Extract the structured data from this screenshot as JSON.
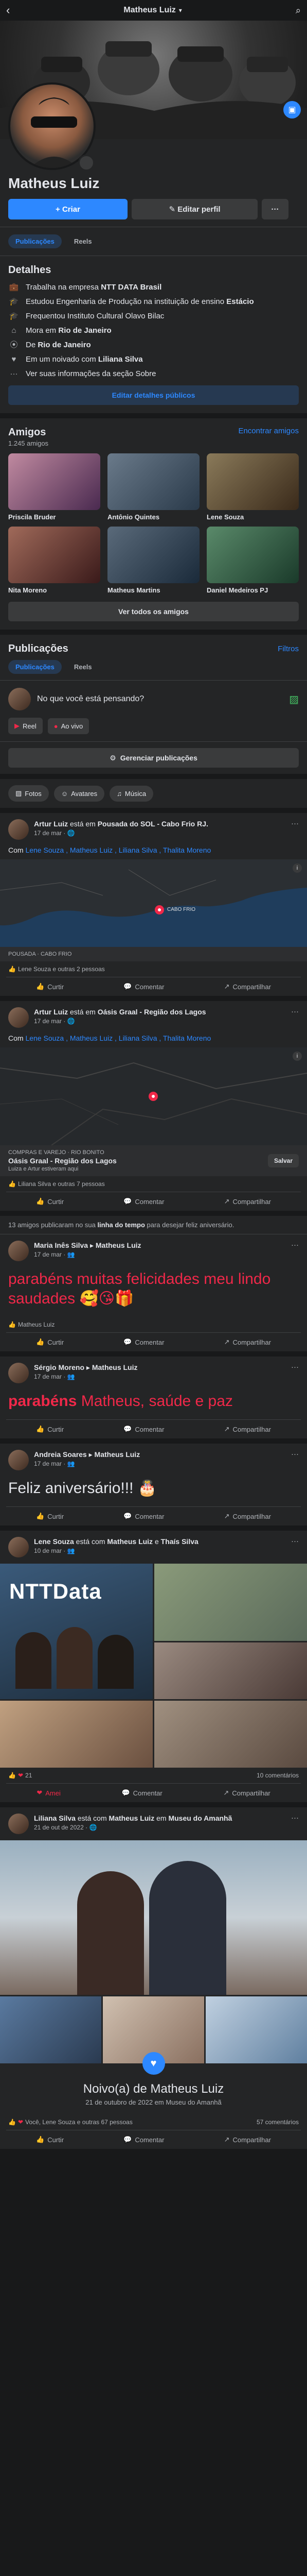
{
  "topbar": {
    "name": "Matheus Luiz",
    "chevron": "▾",
    "search_icon": "search-icon"
  },
  "profile": {
    "name": "Matheus Luiz",
    "create_label": "+ Criar",
    "edit_label": "✎ Editar perfil",
    "more_label": "···"
  },
  "tabs": {
    "posts": "Publicações",
    "reels": "Reels"
  },
  "details": {
    "title": "Detalhes",
    "items": [
      {
        "icon": "briefcase-icon",
        "pre": "Trabalha na empresa ",
        "bold": "NTT DATA Brasil"
      },
      {
        "icon": "graduation-icon",
        "pre": "Estudou Engenharia de Produção na instituição de ensino ",
        "bold": "Estácio"
      },
      {
        "icon": "graduation-icon",
        "pre": "Frequentou Instituto Cultural Olavo Bilac",
        "bold": ""
      },
      {
        "icon": "home-icon",
        "pre": "Mora em ",
        "bold": "Rio de Janeiro"
      },
      {
        "icon": "location-icon",
        "pre": "De ",
        "bold": "Rio de Janeiro"
      },
      {
        "icon": "heart-icon",
        "pre": "Em um noivado com ",
        "bold": "Liliana Silva"
      },
      {
        "icon": "ellipsis-icon",
        "pre": "Ver suas informações da seção Sobre",
        "bold": ""
      }
    ],
    "edit_label": "Editar detalhes públicos"
  },
  "friends": {
    "title": "Amigos",
    "count": "1.245 amigos",
    "find_label": "Encontrar amigos",
    "list": [
      {
        "name": "Priscila Bruder"
      },
      {
        "name": "Antônio Quintes"
      },
      {
        "name": "Lene Souza"
      },
      {
        "name": "Nita Moreno"
      },
      {
        "name": "Matheus Martins"
      },
      {
        "name": "Daniel Medeiros PJ"
      }
    ],
    "see_all": "Ver todos os amigos"
  },
  "publications": {
    "title": "Publicações",
    "filters": "Filtros",
    "tab_posts": "Publicações",
    "tab_reels": "Reels",
    "composer_placeholder": "No que você está pensando?",
    "reel_label": "Reel",
    "live_label": "Ao vivo",
    "manage_label": "Gerenciar publicações",
    "chips": [
      "Fotos",
      "Avatares",
      "Música"
    ]
  },
  "post1": {
    "author": "Artur Luiz",
    "text": " está em ",
    "place": "Pousada do SOL - Cabo Frio RJ.",
    "time": "17 de mar",
    "body_pre": "Com ",
    "tags": "Lene Souza , Matheus Luiz , Liliana Silva , Thalita Moreno",
    "map_label": "CABO FRIO",
    "map_caption": "POUSADA · CABO FRIO",
    "reactions": "Lene Souza e outras 2 pessoas"
  },
  "post2": {
    "author": "Artur Luiz",
    "text": " está em ",
    "place": "Oásis Graal - Região dos Lagos",
    "time": "17 de mar",
    "body_pre": "Com ",
    "tags": "Lene Souza , Matheus Luiz , Liliana Silva , Thalita Moreno",
    "map_caption": "COMPRAS E VAREJO · RIO BONITO",
    "place_name": "Oásis Graal - Região dos Lagos",
    "place_sub": "Luiza e Artur estiveram aqui",
    "save_label": "Salvar",
    "reactions": "Liliana Silva e outras 7 pessoas"
  },
  "birthday_note": {
    "pre": "13 amigos publicaram no sua ",
    "bold": "linha do tempo",
    "post": " para desejar feliz aniversário."
  },
  "post3": {
    "author": "Maria Inês Silva",
    "to": "Matheus Luiz",
    "time": "17 de mar",
    "body": "parabéns muitas felicidades meu lindo saudades 🥰😘🎁",
    "reactions": "Matheus Luiz"
  },
  "post4": {
    "author": "Sérgio Moreno",
    "to": "Matheus Luiz",
    "time": "17 de mar",
    "body_red": "parabéns",
    "body_rest": " Matheus, saúde e paz"
  },
  "post5": {
    "author": "Andreia Soares",
    "to": "Matheus Luiz",
    "time": "17 de mar",
    "body": "Feliz aniversário!!! 🎂"
  },
  "post6": {
    "author": "Lene Souza",
    "text": " está com ",
    "with1": "Matheus Luiz",
    "with2": "Thaís Silva",
    "time": "10 de mar",
    "reactions_count": "21",
    "comments": "10 comentários",
    "photo_label": "NTTData"
  },
  "post7": {
    "author": "Liliana Silva",
    "text": " está com ",
    "with1": "Matheus Luiz",
    "text2": " em ",
    "place": "Museu do Amanhã",
    "time": "21 de out de 2022",
    "banner_title": "Noivo(a) de Matheus Luiz",
    "banner_sub": "21 de outubro de 2022 em Museu do Amanhã",
    "reactions": "Você, Lene Souza e outras 67 pessoas",
    "comments": "57 comentários"
  },
  "actions": {
    "like": "Curtir",
    "comment": "Comentar",
    "share": "Compartilhar"
  },
  "colors": {
    "accent": "#2d88ff",
    "bg": "#18191a",
    "card": "#242526",
    "red": "#f02849"
  }
}
